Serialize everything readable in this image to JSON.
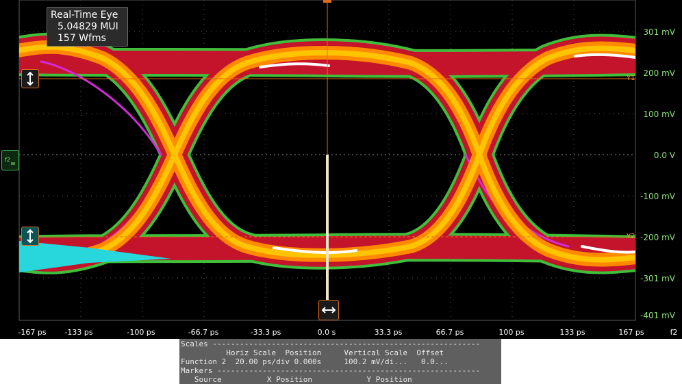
{
  "readout": {
    "title": "Real-Time Eye",
    "ui": "5.04829 MUI",
    "wfms": "157 Wfms"
  },
  "y_axis_labels": [
    "301 mV",
    "200 mV",
    "100 mV",
    "0.0 V",
    "-100 mV",
    "-200 mV",
    "-301 mV",
    "-401 mV"
  ],
  "x_axis_labels": [
    "-167 ps",
    "-133 ps",
    "-100 ps",
    "-66.7 ps",
    "-33.3 ps",
    "0.0 s",
    "33.3 ps",
    "66.7 ps",
    "100 ps",
    "133 ps",
    "167 ps"
  ],
  "trace_tag": "f2",
  "cursor_tags": {
    "y1": "Y1",
    "y2": "Y2"
  },
  "scales_panel": {
    "line1": "Scales -----------------------------------------------------------",
    "line2": "          Horiz Scale  Position     Vertical Scale  Offset",
    "line3": "Function 2  20.00 ps/div 0.000s     100.2 mV/di...   0.0...",
    "line4": "Markers ----------------------------------------------------------",
    "line5": "   Source          X Position            Y Position"
  },
  "colors": {
    "outer": "#3fbf3a",
    "density_low": "#c3142b",
    "density_mid": "#ff8a00",
    "density_high": "#ffc400",
    "peak": "#ffffff",
    "magenta": "#d22bd6",
    "cyan": "#27d7dc",
    "grid": "#5c5c5c",
    "axis_text": "#8fe37b"
  }
}
